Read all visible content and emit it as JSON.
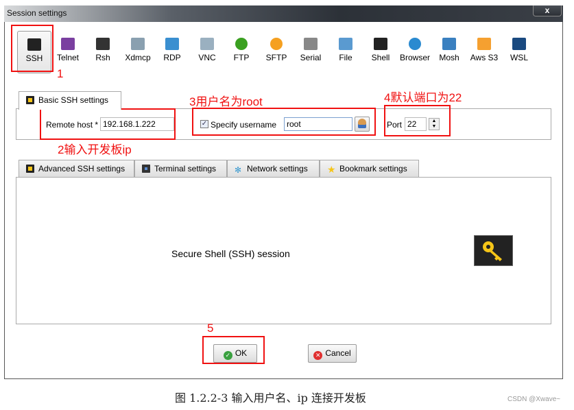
{
  "window": {
    "title": "Session settings",
    "close_label": "x"
  },
  "protocols": [
    {
      "label": "SSH",
      "icon": "ssh-key-icon",
      "color": "#222222"
    },
    {
      "label": "Telnet",
      "icon": "telnet-icon",
      "color": "#7a3fa0"
    },
    {
      "label": "Rsh",
      "icon": "rsh-icon",
      "color": "#333333"
    },
    {
      "label": "Xdmcp",
      "icon": "xdmcp-monitor-icon",
      "color": "#8aa0b0"
    },
    {
      "label": "RDP",
      "icon": "rdp-monitor-icon",
      "color": "#3a8fd0"
    },
    {
      "label": "VNC",
      "icon": "vnc-monitor-icon",
      "color": "#9ab0c0"
    },
    {
      "label": "FTP",
      "icon": "ftp-globe-icon",
      "color": "#3aa020"
    },
    {
      "label": "SFTP",
      "icon": "sftp-globe-icon",
      "color": "#f5a020"
    },
    {
      "label": "Serial",
      "icon": "serial-plug-icon",
      "color": "#888888"
    },
    {
      "label": "File",
      "icon": "file-monitor-icon",
      "color": "#5a9ad0"
    },
    {
      "label": "Shell",
      "icon": "shell-terminal-icon",
      "color": "#222222"
    },
    {
      "label": "Browser",
      "icon": "browser-globe-icon",
      "color": "#2a8ad0"
    },
    {
      "label": "Mosh",
      "icon": "mosh-satellite-icon",
      "color": "#3a80c0"
    },
    {
      "label": "Aws S3",
      "icon": "aws-s3-icon",
      "color": "#f5a030"
    },
    {
      "label": "WSL",
      "icon": "wsl-windows-icon",
      "color": "#1a4a80"
    }
  ],
  "basic_tab": {
    "label": "Basic SSH settings"
  },
  "basic": {
    "remote_host_label": "Remote host *",
    "remote_host_value": "192.168.1.222",
    "specify_username_label": "Specify username",
    "specify_username_checked": true,
    "username_value": "root",
    "port_label": "Port",
    "port_value": "22"
  },
  "tabs": [
    {
      "label": "Advanced SSH settings",
      "icon": "wrench-key-icon"
    },
    {
      "label": "Terminal settings",
      "icon": "terminal-icon"
    },
    {
      "label": "Network settings",
      "icon": "network-icon"
    },
    {
      "label": "Bookmark settings",
      "icon": "star-icon"
    }
  ],
  "content": {
    "description": "Secure Shell (SSH) session"
  },
  "buttons": {
    "ok": "OK",
    "cancel": "Cancel"
  },
  "annotations": {
    "a1": "1",
    "a2": "2输入开发板ip",
    "a3": "3用户名为root",
    "a4": "4默认端口为22",
    "a5": "5"
  },
  "caption": "图 1.2.2-3  输入用户名、ip 连接开发板",
  "watermark": "CSDN @Xwave~",
  "colors": {
    "annotation": "#f01010",
    "accent_key": "#f5c518"
  }
}
